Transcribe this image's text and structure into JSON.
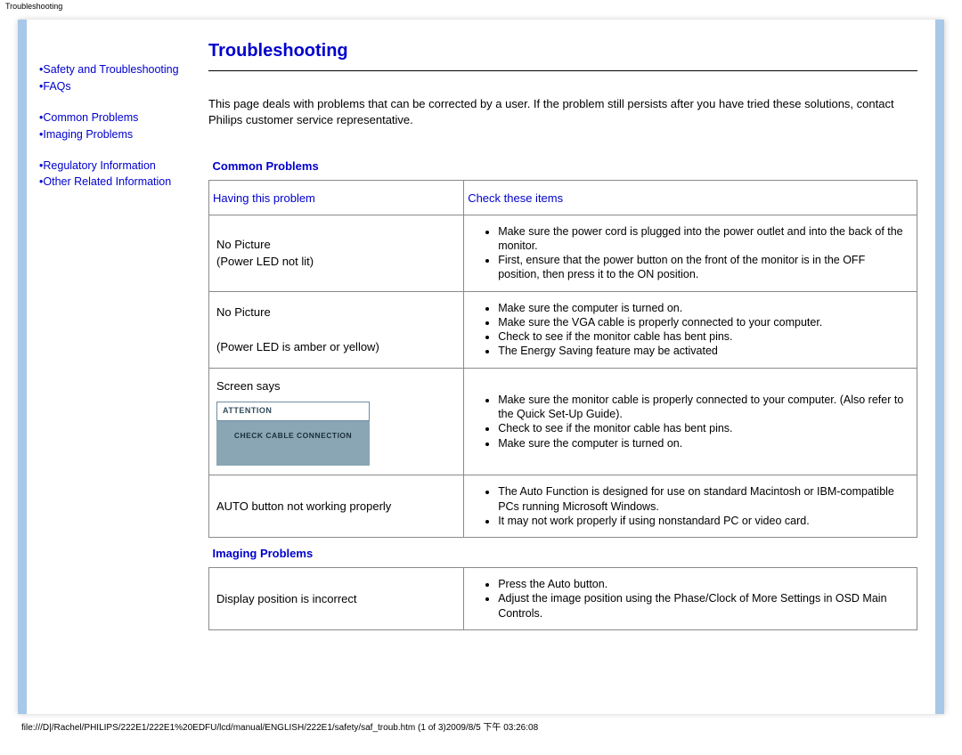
{
  "header_label": "Troubleshooting",
  "sidebar": {
    "groups": [
      {
        "items": [
          {
            "label": "Safety and Troubleshooting"
          },
          {
            "label": "FAQs"
          }
        ]
      },
      {
        "items": [
          {
            "label": "Common Problems"
          },
          {
            "label": "Imaging Problems"
          }
        ]
      },
      {
        "items": [
          {
            "label": "Regulatory Information"
          },
          {
            "label": "Other Related Information"
          }
        ]
      }
    ]
  },
  "main": {
    "title": "Troubleshooting",
    "intro": "This page deals with problems that can be corrected by a user. If the problem still persists after you have tried these solutions, contact Philips customer service representative.",
    "sections": {
      "common_label": "Common Problems",
      "col_problem": "Having this problem",
      "col_check": "Check these items",
      "imaging_label": "Imaging Problems"
    },
    "rows": {
      "r1": {
        "problem_l1": "No Picture",
        "problem_l2": "(Power LED not lit)",
        "items": [
          "Make sure the power cord is plugged into the power outlet and into the back of the monitor.",
          "First, ensure that the power button on the front of the monitor is in the OFF position, then press it to the ON position."
        ]
      },
      "r2": {
        "problem_l1": "No Picture",
        "problem_l2": "(Power LED is amber or yellow)",
        "items": [
          "Make sure the computer is turned on.",
          "Make sure the VGA cable is properly connected to your computer.",
          "Check to see if the monitor cable has bent pins.",
          "The Energy Saving feature may be activated"
        ]
      },
      "r3": {
        "problem_l1": "Screen says",
        "attn_bar": "ATTENTION",
        "attn_body": "CHECK CABLE CONNECTION",
        "items": [
          "Make sure the monitor cable is properly connected to your computer. (Also refer to the Quick Set-Up Guide).",
          "Check to see if the monitor cable has bent pins.",
          "Make sure the computer is turned on."
        ]
      },
      "r4": {
        "problem_l1": "AUTO button not working properly",
        "items": [
          "The Auto Function is designed for use on standard Macintosh or IBM-compatible PCs running Microsoft Windows.",
          "It may not work properly if using nonstandard PC or video card."
        ]
      },
      "r5": {
        "problem_l1": "Display position is incorrect",
        "items": [
          "Press the Auto button.",
          "Adjust the image position using the Phase/Clock of More Settings in OSD Main Controls."
        ]
      }
    }
  },
  "footer_path": "file:///D|/Rachel/PHILIPS/222E1/222E1%20EDFU/lcd/manual/ENGLISH/222E1/safety/saf_troub.htm (1 of 3)2009/8/5 下午 03:26:08"
}
